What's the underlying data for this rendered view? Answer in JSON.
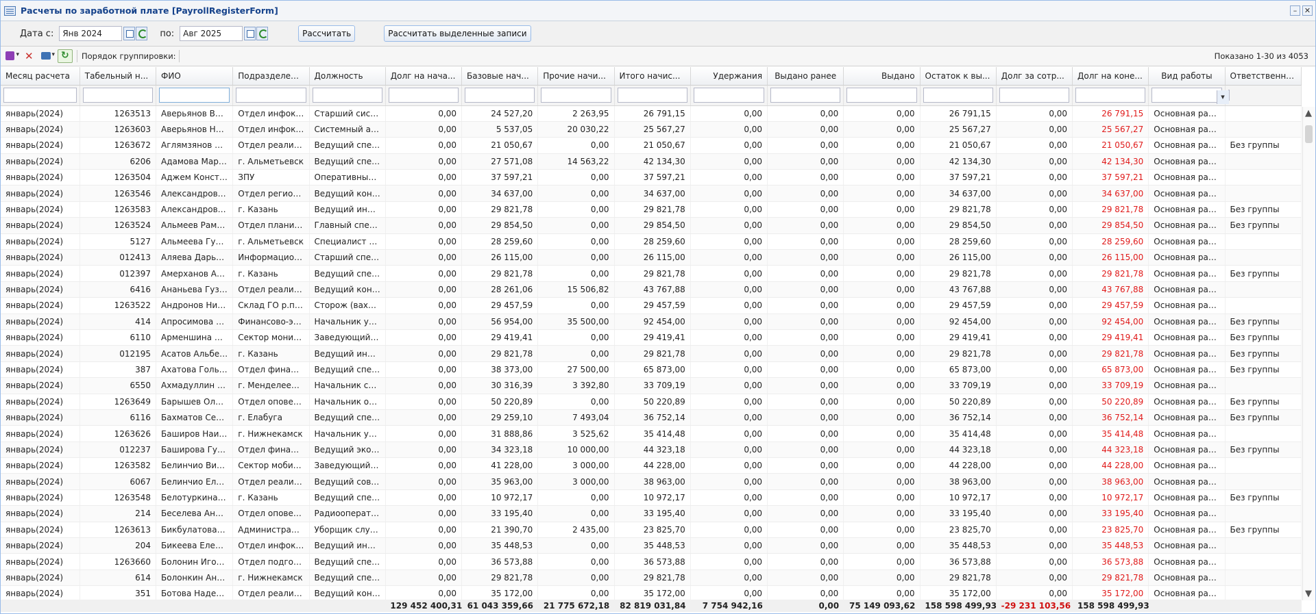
{
  "window": {
    "title": "Расчеты по заработной плате [PayrollRegisterForm]"
  },
  "filter": {
    "date_from_label": "Дата с:",
    "date_from_value": "Янв 2024",
    "date_to_label": "по:",
    "date_to_value": "Авг 2025",
    "calculate_label": "Рассчитать",
    "calculate_selected_label": "Рассчитать выделенные записи"
  },
  "toolbar": {
    "grouping_label": "Порядок группировки:",
    "shown_text": "Показано 1-30 из 4053"
  },
  "columns": [
    "Месяц расчета",
    "Табельный н...",
    "ФИО",
    "Подразделение",
    "Должность",
    "Долг на нача...",
    "Базовые нач...",
    "Прочие начи...",
    "Итого начис...",
    "Удержания",
    "Выдано ранее",
    "Выдано",
    "Остаток к вы...",
    "Долг за сотр...",
    "Долг на коне...",
    "Вид работы",
    "Ответственный..."
  ],
  "rows": [
    [
      "январь(2024)",
      "1263513",
      "Аверьянов Вла...",
      "Отдел инфоком...",
      "Старший систе...",
      "0,00",
      "24 527,20",
      "2 263,95",
      "26 791,15",
      "0,00",
      "0,00",
      "0,00",
      "26 791,15",
      "0,00",
      "26 791,15",
      "Основная работа",
      ""
    ],
    [
      "январь(2024)",
      "1263603",
      "Аверьянов Ник...",
      "Отдел инфоком...",
      "Системный адм...",
      "0,00",
      "5 537,05",
      "20 030,22",
      "25 567,27",
      "0,00",
      "0,00",
      "0,00",
      "25 567,27",
      "0,00",
      "25 567,27",
      "Основная работа",
      ""
    ],
    [
      "январь(2024)",
      "1263672",
      "Аглямзянов Ай...",
      "Отдел реализа...",
      "Ведущий специ...",
      "0,00",
      "21 050,67",
      "0,00",
      "21 050,67",
      "0,00",
      "0,00",
      "0,00",
      "21 050,67",
      "0,00",
      "21 050,67",
      "Основная работа",
      "Без группы"
    ],
    [
      "январь(2024)",
      "6206",
      "Адамова Мария...",
      "г. Альметьевск",
      "Ведущий специ...",
      "0,00",
      "27 571,08",
      "14 563,22",
      "42 134,30",
      "0,00",
      "0,00",
      "0,00",
      "42 134,30",
      "0,00",
      "42 134,30",
      "Основная работа",
      ""
    ],
    [
      "январь(2024)",
      "1263504",
      "Аджем Констан...",
      "ЗПУ",
      "Оперативный д...",
      "0,00",
      "37 597,21",
      "0,00",
      "37 597,21",
      "0,00",
      "0,00",
      "0,00",
      "37 597,21",
      "0,00",
      "37 597,21",
      "Основная работа",
      ""
    ],
    [
      "январь(2024)",
      "1263546",
      "Александров П...",
      "Отдел региона...",
      "Ведущий консу...",
      "0,00",
      "34 637,00",
      "0,00",
      "34 637,00",
      "0,00",
      "0,00",
      "0,00",
      "34 637,00",
      "0,00",
      "34 637,00",
      "Основная работа",
      ""
    ],
    [
      "январь(2024)",
      "1263583",
      "Александрова ...",
      "г. Казань",
      "Ведущий инже...",
      "0,00",
      "29 821,78",
      "0,00",
      "29 821,78",
      "0,00",
      "0,00",
      "0,00",
      "29 821,78",
      "0,00",
      "29 821,78",
      "Основная работа",
      "Без группы"
    ],
    [
      "январь(2024)",
      "1263524",
      "Альмеев Рамил...",
      "Отдел планиро...",
      "Главный специ...",
      "0,00",
      "29 854,50",
      "0,00",
      "29 854,50",
      "0,00",
      "0,00",
      "0,00",
      "29 854,50",
      "0,00",
      "29 854,50",
      "Основная работа",
      "Без группы"
    ],
    [
      "январь(2024)",
      "5127",
      "Альмеева Гуль...",
      "г. Альметьевск",
      "Специалист пе...",
      "0,00",
      "28 259,60",
      "0,00",
      "28 259,60",
      "0,00",
      "0,00",
      "0,00",
      "28 259,60",
      "0,00",
      "28 259,60",
      "Основная работа",
      ""
    ],
    [
      "январь(2024)",
      "012413",
      "Аляева Дарья В...",
      "Информационн...",
      "Старший специ...",
      "0,00",
      "26 115,00",
      "0,00",
      "26 115,00",
      "0,00",
      "0,00",
      "0,00",
      "26 115,00",
      "0,00",
      "26 115,00",
      "Основная работа",
      ""
    ],
    [
      "январь(2024)",
      "012397",
      "Амерханов Аль...",
      "г. Казань",
      "Ведущий специ...",
      "0,00",
      "29 821,78",
      "0,00",
      "29 821,78",
      "0,00",
      "0,00",
      "0,00",
      "29 821,78",
      "0,00",
      "29 821,78",
      "Основная работа",
      "Без группы"
    ],
    [
      "январь(2024)",
      "6416",
      "Ананьева Гузел...",
      "Отдел реализа...",
      "Ведущий консу...",
      "0,00",
      "28 261,06",
      "15 506,82",
      "43 767,88",
      "0,00",
      "0,00",
      "0,00",
      "43 767,88",
      "0,00",
      "43 767,88",
      "Основная работа",
      ""
    ],
    [
      "январь(2024)",
      "1263522",
      "Андронов Нико...",
      "Склад ГО р.п. ...",
      "Сторож (вахтер...",
      "0,00",
      "29 457,59",
      "0,00",
      "29 457,59",
      "0,00",
      "0,00",
      "0,00",
      "29 457,59",
      "0,00",
      "29 457,59",
      "Основная работа",
      ""
    ],
    [
      "январь(2024)",
      "414",
      "Апросимова Лю...",
      "Финансово-эко...",
      "Начальник упр...",
      "0,00",
      "56 954,00",
      "35 500,00",
      "92 454,00",
      "0,00",
      "0,00",
      "0,00",
      "92 454,00",
      "0,00",
      "92 454,00",
      "Основная работа",
      "Без группы"
    ],
    [
      "январь(2024)",
      "6110",
      "Арменшина Ли...",
      "Сектор монито...",
      "Заведующий се...",
      "0,00",
      "29 419,41",
      "0,00",
      "29 419,41",
      "0,00",
      "0,00",
      "0,00",
      "29 419,41",
      "0,00",
      "29 419,41",
      "Основная работа",
      "Без группы"
    ],
    [
      "январь(2024)",
      "012195",
      "Асатов Альберт...",
      "г. Казань",
      "Ведущий инже...",
      "0,00",
      "29 821,78",
      "0,00",
      "29 821,78",
      "0,00",
      "0,00",
      "0,00",
      "29 821,78",
      "0,00",
      "29 821,78",
      "Основная работа",
      "Без группы"
    ],
    [
      "январь(2024)",
      "387",
      "Ахатова Гольну...",
      "Отдел финансо...",
      "Ведущий специ...",
      "0,00",
      "38 373,00",
      "27 500,00",
      "65 873,00",
      "0,00",
      "0,00",
      "0,00",
      "65 873,00",
      "0,00",
      "65 873,00",
      "Основная работа",
      "Без группы"
    ],
    [
      "январь(2024)",
      "6550",
      "Ахмадуллин Ай...",
      "г. Менделеевск",
      "Начальник сам...",
      "0,00",
      "30 316,39",
      "3 392,80",
      "33 709,19",
      "0,00",
      "0,00",
      "0,00",
      "33 709,19",
      "0,00",
      "33 709,19",
      "Основная работа",
      ""
    ],
    [
      "январь(2024)",
      "1263649",
      "Барышев Олег ...",
      "Отдел оповеще...",
      "Начальник отд...",
      "0,00",
      "50 220,89",
      "0,00",
      "50 220,89",
      "0,00",
      "0,00",
      "0,00",
      "50 220,89",
      "0,00",
      "50 220,89",
      "Основная работа",
      "Без группы"
    ],
    [
      "январь(2024)",
      "6116",
      "Бахматов Серге...",
      "г. Елабуга",
      "Ведущий специ...",
      "0,00",
      "29 259,10",
      "7 493,04",
      "36 752,14",
      "0,00",
      "0,00",
      "0,00",
      "36 752,14",
      "0,00",
      "36 752,14",
      "Основная работа",
      "Без группы"
    ],
    [
      "январь(2024)",
      "1263626",
      "Баширов Наиль...",
      "г. Нижнекамск",
      "Начальник упр...",
      "0,00",
      "31 888,86",
      "3 525,62",
      "35 414,48",
      "0,00",
      "0,00",
      "0,00",
      "35 414,48",
      "0,00",
      "35 414,48",
      "Основная работа",
      ""
    ],
    [
      "январь(2024)",
      "012237",
      "Баширова Гузе...",
      "Отдел финансо...",
      "Ведущий эконо...",
      "0,00",
      "34 323,18",
      "10 000,00",
      "44 323,18",
      "0,00",
      "0,00",
      "0,00",
      "44 323,18",
      "0,00",
      "44 323,18",
      "Основная работа",
      "Без группы"
    ],
    [
      "январь(2024)",
      "1263582",
      "Белинчио Викт...",
      "Сектор мобили...",
      "Заведующий се...",
      "0,00",
      "41 228,00",
      "3 000,00",
      "44 228,00",
      "0,00",
      "0,00",
      "0,00",
      "44 228,00",
      "0,00",
      "44 228,00",
      "Основная работа",
      ""
    ],
    [
      "январь(2024)",
      "6067",
      "Белинчио Елен...",
      "Отдел реализа...",
      "Ведущий совет...",
      "0,00",
      "35 963,00",
      "3 000,00",
      "38 963,00",
      "0,00",
      "0,00",
      "0,00",
      "38 963,00",
      "0,00",
      "38 963,00",
      "Основная работа",
      ""
    ],
    [
      "январь(2024)",
      "1263548",
      "Белотуркина А...",
      "г. Казань",
      "Ведущий специ...",
      "0,00",
      "10 972,17",
      "0,00",
      "10 972,17",
      "0,00",
      "0,00",
      "0,00",
      "10 972,17",
      "0,00",
      "10 972,17",
      "Основная работа",
      "Без группы"
    ],
    [
      "январь(2024)",
      "214",
      "Беселева Антон...",
      "Отдел оповеще...",
      "Радиооператор...",
      "0,00",
      "33 195,40",
      "0,00",
      "33 195,40",
      "0,00",
      "0,00",
      "0,00",
      "33 195,40",
      "0,00",
      "33 195,40",
      "Основная работа",
      ""
    ],
    [
      "январь(2024)",
      "1263613",
      "Бикбулатова Ф...",
      "Административ...",
      "Уборщик служе...",
      "0,00",
      "21 390,70",
      "2 435,00",
      "23 825,70",
      "0,00",
      "0,00",
      "0,00",
      "23 825,70",
      "0,00",
      "23 825,70",
      "Основная работа",
      "Без группы"
    ],
    [
      "январь(2024)",
      "204",
      "Бикеева Елена ...",
      "Отдел инфоком...",
      "Ведущий инже...",
      "0,00",
      "35 448,53",
      "0,00",
      "35 448,53",
      "0,00",
      "0,00",
      "0,00",
      "35 448,53",
      "0,00",
      "35 448,53",
      "Основная работа",
      ""
    ],
    [
      "январь(2024)",
      "1263660",
      "Болонин Игорь ...",
      "Отдел подготов...",
      "Ведущий специ...",
      "0,00",
      "36 573,88",
      "0,00",
      "36 573,88",
      "0,00",
      "0,00",
      "0,00",
      "36 573,88",
      "0,00",
      "36 573,88",
      "Основная работа",
      ""
    ],
    [
      "январь(2024)",
      "614",
      "Болонкин Андр...",
      "г. Нижнекамск",
      "Ведущий специ...",
      "0,00",
      "29 821,78",
      "0,00",
      "29 821,78",
      "0,00",
      "0,00",
      "0,00",
      "29 821,78",
      "0,00",
      "29 821,78",
      "Основная работа",
      ""
    ],
    [
      "январь(2024)",
      "351",
      "Ботова Надежд...",
      "Отдел реализа...",
      "Ведущий консу...",
      "0,00",
      "35 172,00",
      "0,00",
      "35 172,00",
      "0,00",
      "0,00",
      "0,00",
      "35 172,00",
      "0,00",
      "35 172,00",
      "Основная работа",
      ""
    ]
  ],
  "totals": [
    "",
    "",
    "",
    "",
    "",
    "129 452 400,31",
    "61 043 359,66",
    "21 775 672,18",
    "82 819 031,84",
    "7 754 942,16",
    "0,00",
    "75 149 093,62",
    "158 598 499,93",
    "-29 231 103,56",
    "158 598 499,93",
    "",
    ""
  ],
  "colors": {
    "debt_end_red": "#e01a1a",
    "header_blue": "#15428b"
  }
}
